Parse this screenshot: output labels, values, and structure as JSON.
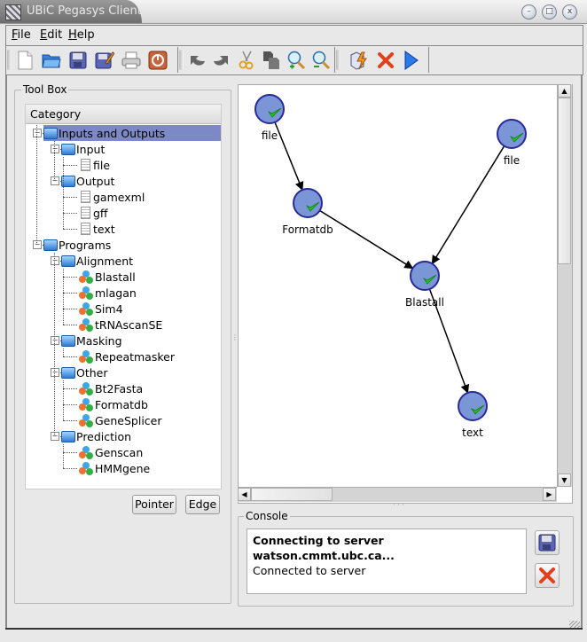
{
  "window": {
    "title": "UBiC Pegasys Client",
    "controls": [
      "minimize",
      "maximize",
      "close"
    ]
  },
  "menubar": {
    "items": [
      {
        "label": "File",
        "mnemonic": "F"
      },
      {
        "label": "Edit",
        "mnemonic": "E"
      },
      {
        "label": "Help",
        "mnemonic": "H"
      }
    ]
  },
  "toolbar": {
    "groups": [
      [
        {
          "icon": "new-document-icon",
          "tooltip": "New"
        },
        {
          "icon": "open-folder-icon",
          "tooltip": "Open"
        },
        {
          "icon": "save-icon",
          "tooltip": "Save"
        },
        {
          "icon": "save-as-icon",
          "tooltip": "Save As"
        },
        {
          "icon": "print-icon",
          "tooltip": "Print"
        },
        {
          "icon": "exit-icon",
          "tooltip": "Exit"
        }
      ],
      [
        {
          "icon": "undo-icon",
          "tooltip": "Undo"
        },
        {
          "icon": "redo-icon",
          "tooltip": "Redo"
        },
        {
          "icon": "cut-icon",
          "tooltip": "Cut"
        },
        {
          "icon": "copy-icon",
          "tooltip": "Copy"
        },
        {
          "icon": "zoom-in-icon",
          "tooltip": "Zoom In"
        },
        {
          "icon": "zoom-out-icon",
          "tooltip": "Zoom Out"
        }
      ],
      [
        {
          "icon": "validate-icon",
          "tooltip": "Validate"
        },
        {
          "icon": "stop-icon",
          "tooltip": "Stop"
        },
        {
          "icon": "run-icon",
          "tooltip": "Run"
        }
      ]
    ]
  },
  "toolbox": {
    "title": "Tool Box",
    "tree_header": "Category",
    "tree": [
      {
        "label": "Inputs and Outputs",
        "type": "folder",
        "depth": 0,
        "selected": true
      },
      {
        "label": "Input",
        "type": "folder",
        "depth": 1
      },
      {
        "label": "file",
        "type": "doc",
        "depth": 2
      },
      {
        "label": "Output",
        "type": "folder",
        "depth": 1
      },
      {
        "label": "gamexml",
        "type": "doc",
        "depth": 2
      },
      {
        "label": "gff",
        "type": "doc",
        "depth": 2
      },
      {
        "label": "text",
        "type": "doc",
        "depth": 2
      },
      {
        "label": "Programs",
        "type": "folder",
        "depth": 0
      },
      {
        "label": "Alignment",
        "type": "folder",
        "depth": 1
      },
      {
        "label": "Blastall",
        "type": "program",
        "depth": 2
      },
      {
        "label": "mlagan",
        "type": "program",
        "depth": 2
      },
      {
        "label": "Sim4",
        "type": "program",
        "depth": 2
      },
      {
        "label": "tRNAscanSE",
        "type": "program",
        "depth": 2
      },
      {
        "label": "Masking",
        "type": "folder",
        "depth": 1
      },
      {
        "label": "Repeatmasker",
        "type": "program",
        "depth": 2
      },
      {
        "label": "Other",
        "type": "folder",
        "depth": 1
      },
      {
        "label": "Bt2Fasta",
        "type": "program",
        "depth": 2
      },
      {
        "label": "Formatdb",
        "type": "program",
        "depth": 2
      },
      {
        "label": "GeneSplicer",
        "type": "program",
        "depth": 2
      },
      {
        "label": "Prediction",
        "type": "folder",
        "depth": 1
      },
      {
        "label": "Genscan",
        "type": "program",
        "depth": 2
      },
      {
        "label": "HMMgene",
        "type": "program",
        "depth": 2
      }
    ],
    "buttons": {
      "pointer": "Pointer",
      "edge": "Edge"
    }
  },
  "workflow": {
    "nodes": [
      {
        "id": "file1",
        "label": "file",
        "status": "ok"
      },
      {
        "id": "formatdb",
        "label": "Formatdb",
        "status": "ok"
      },
      {
        "id": "file2",
        "label": "file",
        "status": "ok"
      },
      {
        "id": "blastall",
        "label": "Blastall",
        "status": "ok"
      },
      {
        "id": "text",
        "label": "text",
        "status": "ok"
      }
    ],
    "edges": [
      {
        "from": "file1",
        "to": "formatdb"
      },
      {
        "from": "formatdb",
        "to": "blastall"
      },
      {
        "from": "file2",
        "to": "blastall"
      },
      {
        "from": "blastall",
        "to": "text"
      }
    ],
    "colors": {
      "node_fill": "#7b96d6",
      "node_stroke": "#2a2a9a",
      "check": "#22c422"
    }
  },
  "console": {
    "title": "Console",
    "lines": [
      {
        "text": "Connecting to server watson.cmmt.ubc.ca...",
        "bold": true
      },
      {
        "text": "Connected to server",
        "bold": false
      }
    ],
    "buttons": {
      "save": "save-console-button",
      "clear": "clear-console-button"
    }
  }
}
